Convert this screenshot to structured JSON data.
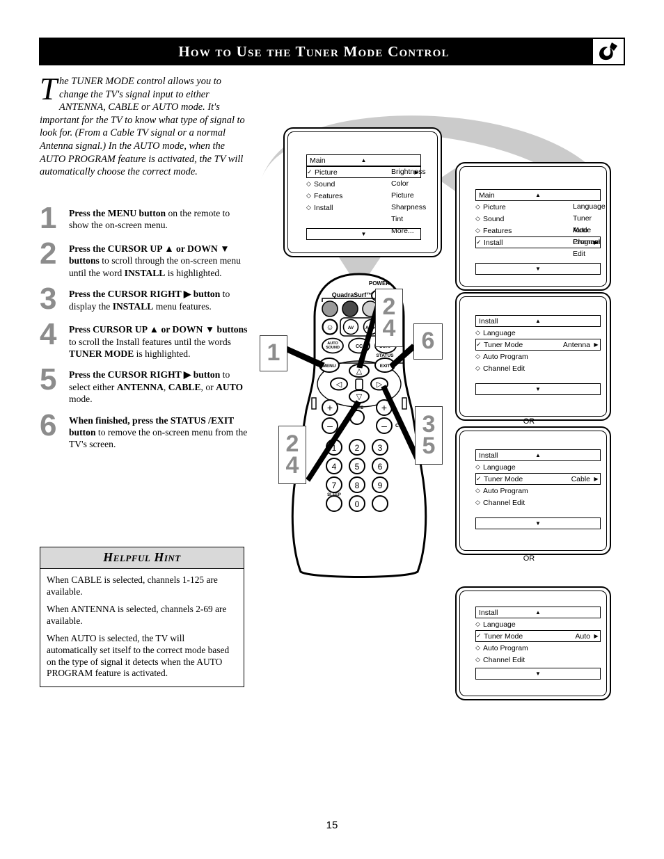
{
  "header": {
    "title": "How to Use the Tuner Mode Control",
    "logo_icon": "philips-shield-icon"
  },
  "intro": {
    "dropcap": "T",
    "text": "he TUNER MODE control allows you to change the TV's signal input to either ANTENNA, CABLE or AUTO mode. It's important for the TV to know what type of signal to look for. (From a Cable TV signal or a normal Antenna signal.) In the AUTO mode, when the AUTO PROGRAM feature is activated, the TV will automatically choose the correct mode."
  },
  "steps": [
    {
      "num": "1",
      "html": "<b>Press the MENU button</b> on the remote to show the on-screen menu."
    },
    {
      "num": "2",
      "html": "<b>Press the CURSOR UP ▲ or DOWN ▼ buttons</b> to scroll through the on-screen menu until the word <b>INSTALL</b> is highlighted."
    },
    {
      "num": "3",
      "html": "<b>Press the CURSOR RIGHT ▶ button</b> to display the <b>INSTALL</b> menu features."
    },
    {
      "num": "4",
      "html": "<b>Press CURSOR UP ▲ or DOWN ▼ buttons</b> to scroll the Install features until the words <b>TUNER MODE</b> is highlighted."
    },
    {
      "num": "5",
      "html": "<b>Press the CURSOR RIGHT ▶ button</b> to select either <b>ANTENNA</b>, <b>CABLE</b>, or <b>AUTO</b> mode."
    },
    {
      "num": "6",
      "html": "<b>When finished, press the STATUS /EXIT button</b> to remove the on-screen menu from the TV's screen."
    }
  ],
  "hint": {
    "title": "Helpful Hint",
    "paragraphs": [
      "When CABLE is selected, channels 1-125 are available.",
      "When ANTENNA is selected, channels 2-69 are available.",
      "When AUTO is selected, the TV will automatically set itself to the correct mode based on the type of signal it detects when the AUTO PROGRAM feature is activated."
    ]
  },
  "screens": [
    {
      "id": "main-picture",
      "bar": {
        "label": "Main",
        "arrow": "▲"
      },
      "rows": [
        {
          "mark": "✓",
          "name": "Picture",
          "val": "",
          "arrow": "▶",
          "selected": true
        },
        {
          "mark": "◇",
          "name": "Sound",
          "val": "",
          "arrow": "",
          "selected": false
        },
        {
          "mark": "◇",
          "name": "Features",
          "val": "",
          "arrow": "",
          "selected": false
        },
        {
          "mark": "◇",
          "name": "Install",
          "val": "",
          "arrow": "",
          "selected": false
        }
      ],
      "right": [
        "Brightness",
        "Color",
        "Picture",
        "Sharpness",
        "Tint",
        "More..."
      ],
      "bottom_arrow": "▼"
    },
    {
      "id": "main-install",
      "bar": {
        "label": "Main",
        "arrow": "▲"
      },
      "rows": [
        {
          "mark": "◇",
          "name": "Picture",
          "val": "",
          "arrow": "",
          "selected": false
        },
        {
          "mark": "◇",
          "name": "Sound",
          "val": "",
          "arrow": "",
          "selected": false
        },
        {
          "mark": "◇",
          "name": "Features",
          "val": "",
          "arrow": "",
          "selected": false
        },
        {
          "mark": "✓",
          "name": "Install",
          "val": "",
          "arrow": "▶",
          "selected": true
        }
      ],
      "right": [
        "Language",
        "Tuner Mode",
        "Auto Program",
        "Channel Edit"
      ],
      "bottom_arrow": "▼"
    },
    {
      "id": "install-antenna",
      "bar": {
        "label": "Install",
        "arrow": "▲"
      },
      "rows": [
        {
          "mark": "◇",
          "name": "Language",
          "val": "",
          "arrow": "",
          "selected": false
        },
        {
          "mark": "✓",
          "name": "Tuner Mode",
          "val": "Antenna",
          "arrow": "▶",
          "selected": true
        },
        {
          "mark": "◇",
          "name": "Auto Program",
          "val": "",
          "arrow": "",
          "selected": false
        },
        {
          "mark": "◇",
          "name": "Channel Edit",
          "val": "",
          "arrow": "",
          "selected": false
        }
      ],
      "right": [],
      "bottom_arrow": "▼"
    },
    {
      "id": "install-cable",
      "bar": {
        "label": "Install",
        "arrow": "▲"
      },
      "rows": [
        {
          "mark": "◇",
          "name": "Language",
          "val": "",
          "arrow": "",
          "selected": false
        },
        {
          "mark": "✓",
          "name": "Tuner Mode",
          "val": "Cable",
          "arrow": "▶",
          "selected": true
        },
        {
          "mark": "◇",
          "name": "Auto Program",
          "val": "",
          "arrow": "",
          "selected": false
        },
        {
          "mark": "◇",
          "name": "Channel Edit",
          "val": "",
          "arrow": "",
          "selected": false
        }
      ],
      "right": [],
      "bottom_arrow": "▼"
    },
    {
      "id": "install-auto",
      "bar": {
        "label": "Install",
        "arrow": "▲"
      },
      "rows": [
        {
          "mark": "◇",
          "name": "Language",
          "val": "",
          "arrow": "",
          "selected": false
        },
        {
          "mark": "✓",
          "name": "Tuner Mode",
          "val": "Auto",
          "arrow": "▶",
          "selected": true
        },
        {
          "mark": "◇",
          "name": "Auto Program",
          "val": "",
          "arrow": "",
          "selected": false
        },
        {
          "mark": "◇",
          "name": "Channel Edit",
          "val": "",
          "arrow": "",
          "selected": false
        }
      ],
      "right": [],
      "bottom_arrow": "▼"
    }
  ],
  "or_labels": [
    "OR",
    "OR"
  ],
  "callouts": [
    {
      "id": "callout-1",
      "lines": [
        "1"
      ]
    },
    {
      "id": "callout-2-4a",
      "lines": [
        "2",
        "4"
      ]
    },
    {
      "id": "callout-2-4b",
      "lines": [
        "2",
        "4"
      ]
    },
    {
      "id": "callout-6",
      "lines": [
        "6"
      ]
    },
    {
      "id": "callout-3-5",
      "lines": [
        "3",
        "5"
      ]
    }
  ],
  "remote": {
    "power_label": "POWER",
    "brand_label": "QuadraSurf™",
    "buttons": [
      {
        "id": "smiley-button",
        "label": "☺"
      },
      {
        "id": "av-button",
        "label": "AV"
      },
      {
        "id": "ach-button",
        "label": "A/CH"
      },
      {
        "id": "auto-sound-button",
        "label": "AUTO SOUND"
      },
      {
        "id": "cc-button",
        "label": "CC"
      },
      {
        "id": "surf-button",
        "label": "SURF"
      },
      {
        "id": "menu-button",
        "label": "MENU"
      },
      {
        "id": "status-exit-button",
        "label": "EXIT"
      }
    ],
    "status_label": "STATUS",
    "mute_label": "MUTE",
    "ch_label": "CH",
    "sleep_label": "SLEEP",
    "keypad": [
      "1",
      "2",
      "3",
      "4",
      "5",
      "6",
      "7",
      "8",
      "9",
      "0"
    ]
  },
  "footer": {
    "page_number": "15"
  },
  "colors": {
    "header_bg": "#000000",
    "callout_number": "#8c8c8c",
    "hint_header_bg": "#d9d9d9",
    "swoosh_gray": "#cccccc"
  }
}
